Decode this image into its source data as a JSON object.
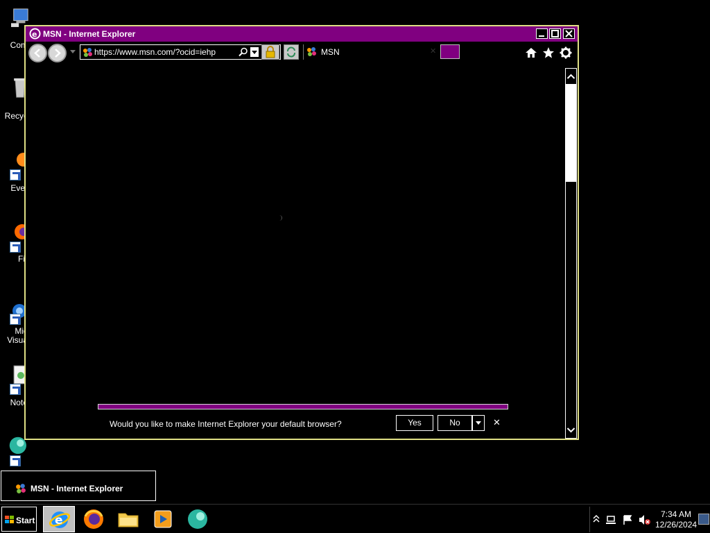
{
  "desktop": {
    "icons": [
      {
        "label": "Com"
      },
      {
        "label": "Recyc"
      },
      {
        "label": "Ever"
      },
      {
        "label": "Fir"
      },
      {
        "label": "Mic"
      },
      {
        "label": "Visua"
      },
      {
        "label": "Note"
      }
    ]
  },
  "window": {
    "title": "MSN - Internet Explorer",
    "address": "https://www.msn.com/?ocid=iehp",
    "tab_title": "MSN",
    "notification": {
      "message": "Would you like to make Internet Explorer your default browser?",
      "yes_label": "Yes",
      "no_label": "No",
      "close_label": "✕"
    }
  },
  "taskbar": {
    "start_label": "Start",
    "thumbnail_label": "MSN - Internet Explorer",
    "time": "7:34 AM",
    "date": "12/26/2024"
  },
  "colors": {
    "accent": "#800080",
    "window_border": "#e0e085"
  }
}
